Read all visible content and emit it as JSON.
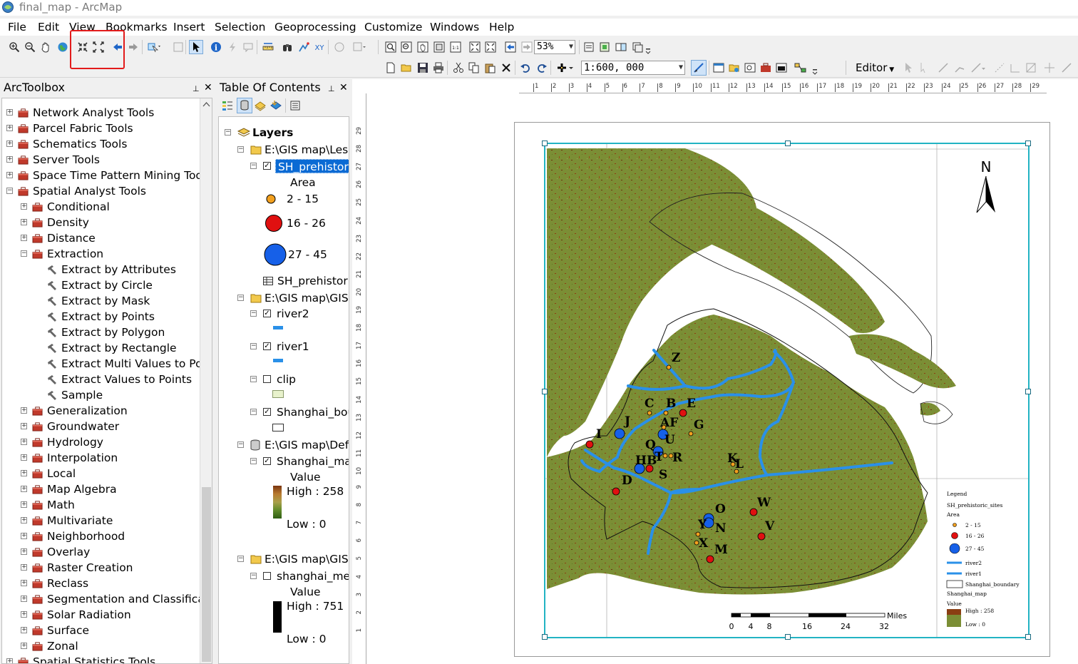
{
  "window": {
    "title": "final_map - ArcMap"
  },
  "menu": [
    "File",
    "Edit",
    "View",
    "Bookmarks",
    "Insert",
    "Selection",
    "Geoprocessing",
    "Customize",
    "Windows",
    "Help"
  ],
  "toolbar": {
    "zoom_percent": "53%",
    "scale": "1:600, 000",
    "editor_label": "Editor"
  },
  "arctoolbox": {
    "title": "ArcToolbox",
    "items": [
      {
        "label": "Network Analyst Tools",
        "level": 0,
        "type": "toolbox",
        "expanded": false
      },
      {
        "label": "Parcel Fabric Tools",
        "level": 0,
        "type": "toolbox",
        "expanded": false
      },
      {
        "label": "Schematics Tools",
        "level": 0,
        "type": "toolbox",
        "expanded": false
      },
      {
        "label": "Server Tools",
        "level": 0,
        "type": "toolbox",
        "expanded": false
      },
      {
        "label": "Space Time Pattern Mining Tool",
        "level": 0,
        "type": "toolbox",
        "expanded": false
      },
      {
        "label": "Spatial Analyst Tools",
        "level": 0,
        "type": "toolbox",
        "expanded": true
      },
      {
        "label": "Conditional",
        "level": 1,
        "type": "toolset",
        "expanded": false
      },
      {
        "label": "Density",
        "level": 1,
        "type": "toolset",
        "expanded": false
      },
      {
        "label": "Distance",
        "level": 1,
        "type": "toolset",
        "expanded": false
      },
      {
        "label": "Extraction",
        "level": 1,
        "type": "toolset",
        "expanded": true
      },
      {
        "label": "Extract by Attributes",
        "level": 2,
        "type": "tool"
      },
      {
        "label": "Extract by Circle",
        "level": 2,
        "type": "tool"
      },
      {
        "label": "Extract by Mask",
        "level": 2,
        "type": "tool"
      },
      {
        "label": "Extract by Points",
        "level": 2,
        "type": "tool"
      },
      {
        "label": "Extract by Polygon",
        "level": 2,
        "type": "tool"
      },
      {
        "label": "Extract by Rectangle",
        "level": 2,
        "type": "tool"
      },
      {
        "label": "Extract Multi Values to Poir",
        "level": 2,
        "type": "tool"
      },
      {
        "label": "Extract Values to Points",
        "level": 2,
        "type": "tool"
      },
      {
        "label": "Sample",
        "level": 2,
        "type": "tool"
      },
      {
        "label": "Generalization",
        "level": 1,
        "type": "toolset",
        "expanded": false
      },
      {
        "label": "Groundwater",
        "level": 1,
        "type": "toolset",
        "expanded": false
      },
      {
        "label": "Hydrology",
        "level": 1,
        "type": "toolset",
        "expanded": false
      },
      {
        "label": "Interpolation",
        "level": 1,
        "type": "toolset",
        "expanded": false
      },
      {
        "label": "Local",
        "level": 1,
        "type": "toolset",
        "expanded": false
      },
      {
        "label": "Map Algebra",
        "level": 1,
        "type": "toolset",
        "expanded": false
      },
      {
        "label": "Math",
        "level": 1,
        "type": "toolset",
        "expanded": false
      },
      {
        "label": "Multivariate",
        "level": 1,
        "type": "toolset",
        "expanded": false
      },
      {
        "label": "Neighborhood",
        "level": 1,
        "type": "toolset",
        "expanded": false
      },
      {
        "label": "Overlay",
        "level": 1,
        "type": "toolset",
        "expanded": false
      },
      {
        "label": "Raster Creation",
        "level": 1,
        "type": "toolset",
        "expanded": false
      },
      {
        "label": "Reclass",
        "level": 1,
        "type": "toolset",
        "expanded": false
      },
      {
        "label": "Segmentation and Classificati",
        "level": 1,
        "type": "toolset",
        "expanded": false
      },
      {
        "label": "Solar Radiation",
        "level": 1,
        "type": "toolset",
        "expanded": false
      },
      {
        "label": "Surface",
        "level": 1,
        "type": "toolset",
        "expanded": false
      },
      {
        "label": "Zonal",
        "level": 1,
        "type": "toolset",
        "expanded": false
      },
      {
        "label": "Spatial Statistics Tools",
        "level": 0,
        "type": "toolbox",
        "expanded": false
      }
    ]
  },
  "toc": {
    "title": "Table Of Contents",
    "root": "Layers",
    "groups": [
      {
        "path": "E:\\GIS map\\Lesso",
        "layer": "SH_prehistori",
        "field": "Area",
        "classes": [
          "2 - 15",
          "16 - 26",
          "27 - 45"
        ],
        "table": "SH_prehistori"
      },
      {
        "path": "E:\\GIS map\\GIS F",
        "layers": [
          "river2",
          "river1",
          "clip",
          "Shanghai_bou"
        ]
      },
      {
        "path": "E:\\GIS map\\Defa",
        "layer": "Shanghai_maj",
        "value_label": "Value",
        "high": "High : 258",
        "low": "Low : 0"
      },
      {
        "path": "E:\\GIS map\\GIS F",
        "layer": "shanghai_mer",
        "value_label": "Value",
        "high": "High : 751",
        "low": "Low : 0"
      }
    ]
  },
  "map": {
    "north": "N",
    "site_labels": [
      "Z",
      "C",
      "B",
      "E",
      "AF",
      "G",
      "J",
      "I",
      "Q",
      "U",
      "HB",
      "T",
      "R",
      "K",
      "L",
      "D",
      "S",
      "W",
      "O",
      "Y",
      "N",
      "V",
      "X",
      "M"
    ],
    "scalebar": {
      "ticks": [
        "0",
        "4",
        "8",
        "16",
        "24",
        "32"
      ],
      "unit": "Miles"
    },
    "legend": {
      "title": "Legend",
      "layer": "SH_prehistoric_sites",
      "field": "Area",
      "classes": [
        "2 - 15",
        "16 - 26",
        "27 - 45"
      ],
      "items": [
        "river2",
        "river1",
        "Shanghai_boundary",
        "Shanghai_map",
        "Value",
        "High : 258",
        "Low : 0"
      ]
    },
    "colors": {
      "land": "#7c8f33",
      "river": "#2a90e8",
      "site_small": "#f2a01f",
      "site_mid": "#e01010",
      "site_large": "#1660e8",
      "frame": "#22b3c3"
    }
  },
  "rulers": {
    "top": [
      "1",
      "2",
      "3",
      "4",
      "5",
      "6",
      "7",
      "8",
      "9",
      "10",
      "11",
      "12",
      "13",
      "14",
      "15",
      "16",
      "17",
      "18",
      "19",
      "20",
      "21",
      "22",
      "23",
      "24",
      "25",
      "26",
      "27",
      "28",
      "29"
    ],
    "left": [
      "29",
      "28",
      "27",
      "26",
      "25",
      "24",
      "23",
      "22",
      "21",
      "20",
      "19",
      "18",
      "17",
      "16",
      "15",
      "14",
      "13",
      "12",
      "11",
      "10",
      "9",
      "8",
      "7",
      "6",
      "5",
      "4",
      "3",
      "2",
      "1"
    ]
  }
}
